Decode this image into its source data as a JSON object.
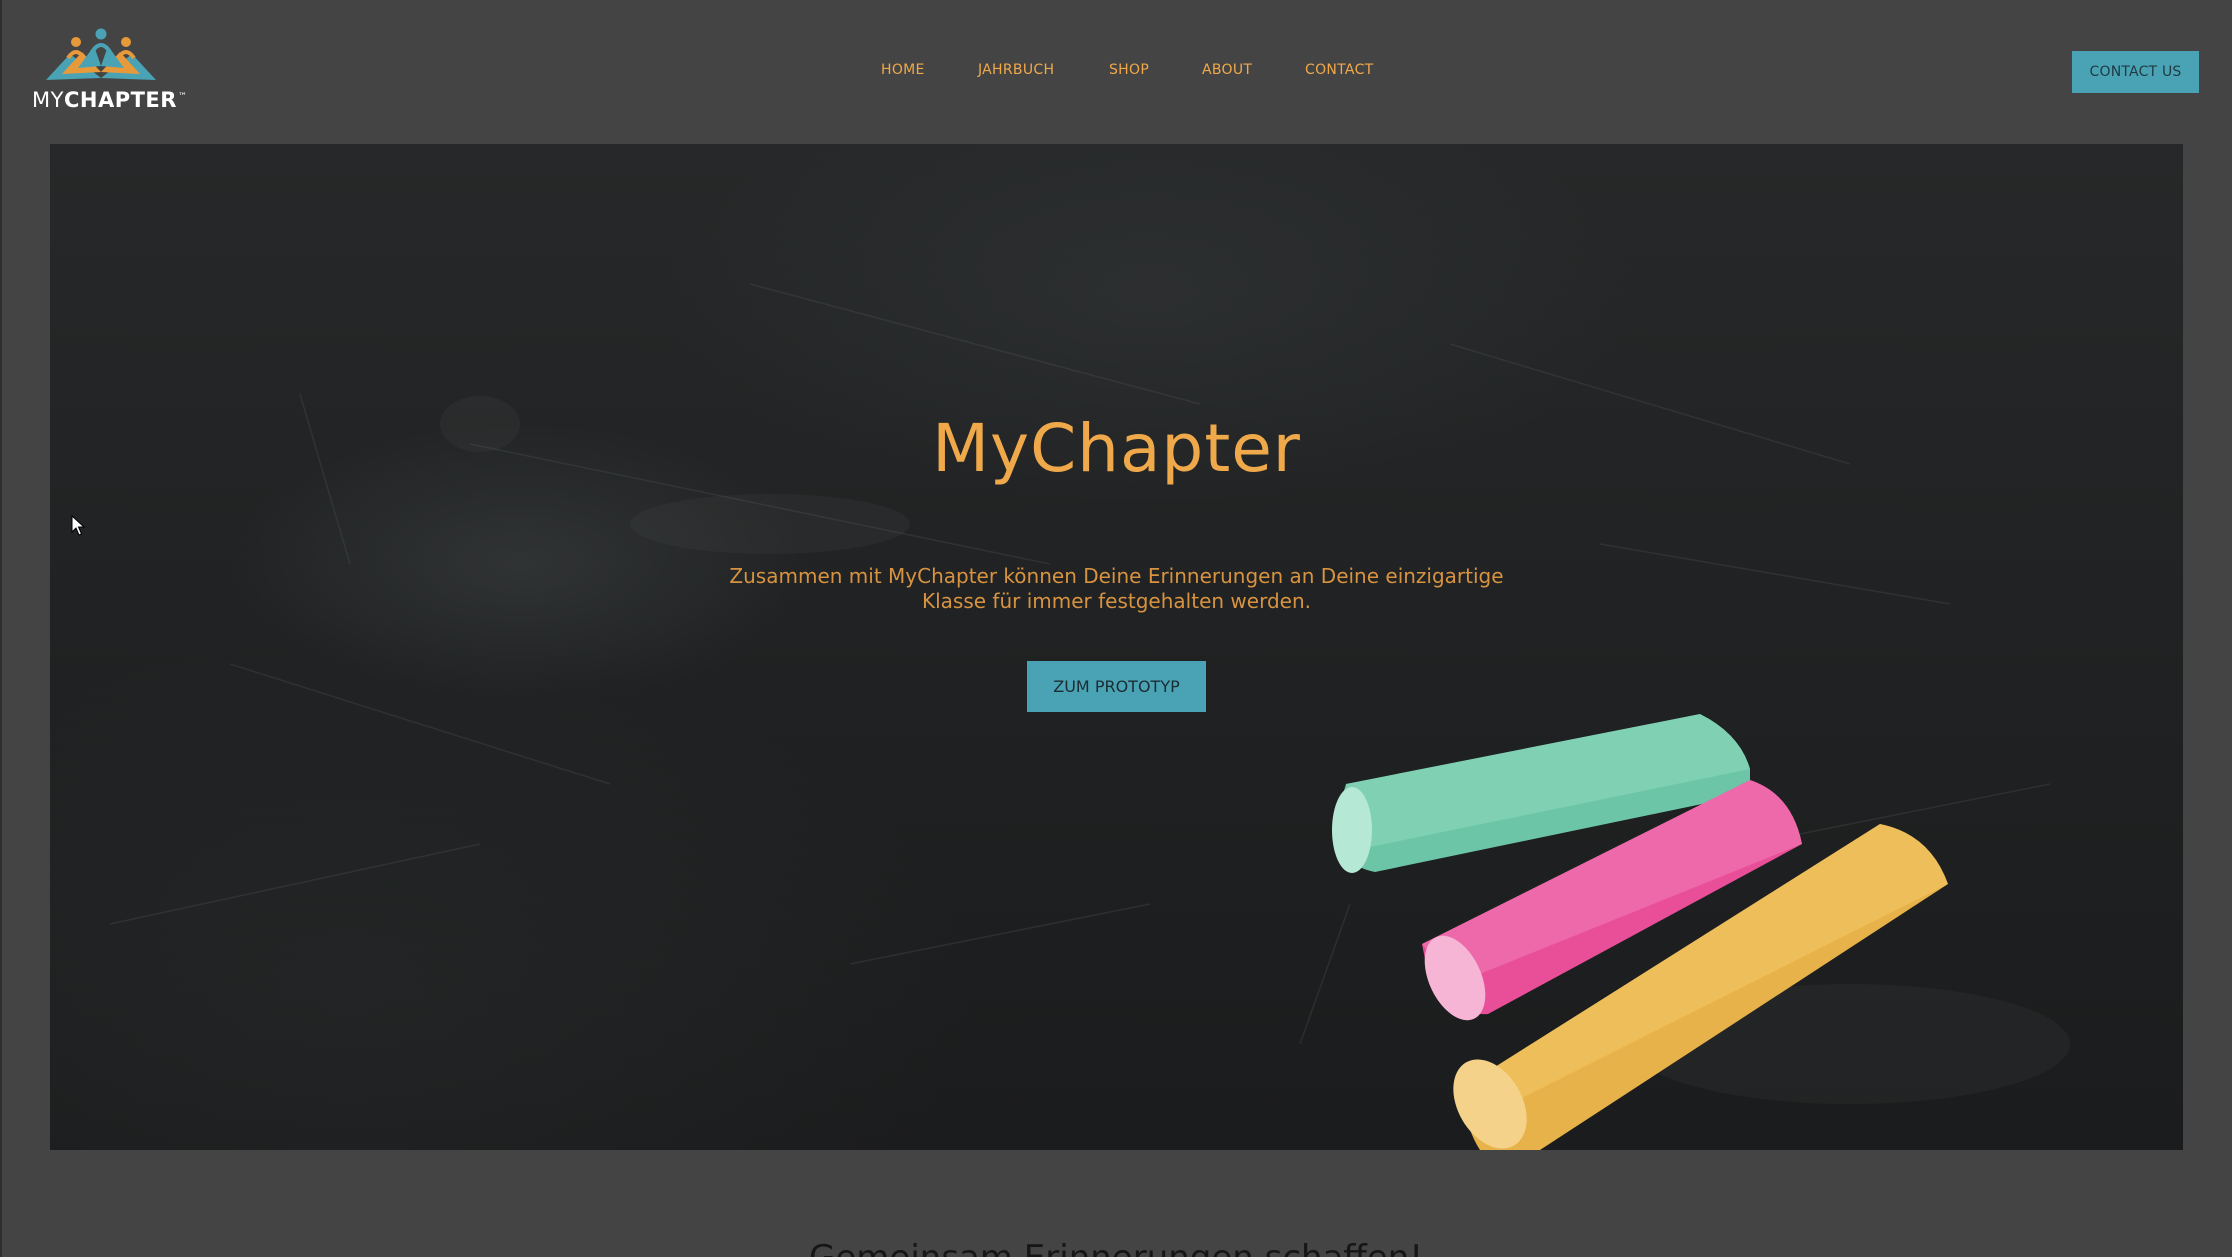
{
  "brand": {
    "name_light": "MY",
    "name_bold": "CHAPTER",
    "trademark": "™"
  },
  "nav": {
    "items": [
      {
        "label": "HOME"
      },
      {
        "label": "JAHRBUCH"
      },
      {
        "label": "SHOP"
      },
      {
        "label": "ABOUT"
      },
      {
        "label": "CONTACT"
      }
    ],
    "contact_button": "CONTACT US"
  },
  "hero": {
    "title": "MyChapter",
    "subtitle_line1": "Zusammen mit MyChapter können Deine Erinnerungen an Deine einzigartige",
    "subtitle_line2": "Klasse für immer festgehalten werden.",
    "cta_label": "ZUM PROTOTYP"
  },
  "section": {
    "heading": "Gemeinsam Erinnerungen schaffen!"
  },
  "colors": {
    "accent_orange": "#f0a94a",
    "accent_teal": "#4aa3b4",
    "header_bg": "#444444"
  },
  "icons": {
    "logo": "open-book-people-logo",
    "cursor": "mouse-pointer-icon"
  }
}
